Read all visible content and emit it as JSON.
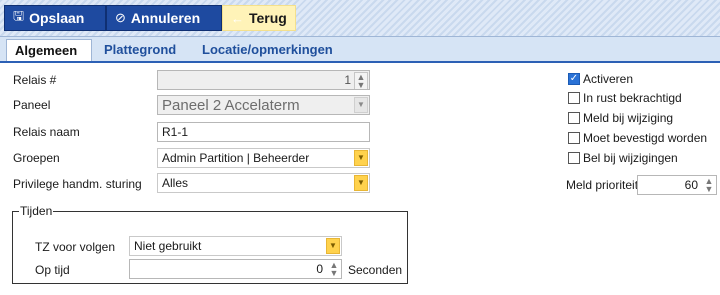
{
  "toolbar": {
    "save_label": "Opslaan",
    "cancel_label": "Annuleren",
    "back_label": "Terug"
  },
  "tabs": [
    {
      "label": "Algemeen",
      "active": true
    },
    {
      "label": "Plattegrond",
      "active": false
    },
    {
      "label": "Locatie/opmerkingen",
      "active": false
    }
  ],
  "form": {
    "relais_nr": {
      "label": "Relais #",
      "value": "1"
    },
    "paneel": {
      "label": "Paneel",
      "value": "Paneel 2 Accelaterm"
    },
    "relais_naam": {
      "label": "Relais naam",
      "value": "R1-1"
    },
    "groepen": {
      "label": "Groepen",
      "value": "Admin Partition | Beheerder"
    },
    "privilege": {
      "label": "Privilege handm. sturing",
      "value": "Alles"
    }
  },
  "checkboxes": [
    {
      "label": "Activeren",
      "checked": true
    },
    {
      "label": "In rust bekrachtigd",
      "checked": false
    },
    {
      "label": "Meld bij wijziging",
      "checked": false
    },
    {
      "label": "Moet bevestigd worden",
      "checked": false
    },
    {
      "label": "Bel bij wijzigingen",
      "checked": false
    }
  ],
  "meld_prioriteit": {
    "label": "Meld prioriteit",
    "value": "60"
  },
  "tijden": {
    "legend": "Tijden",
    "tz_label": "TZ voor volgen",
    "tz_value": "Niet gebruikt",
    "op_tijd_label": "Op tijd",
    "op_tijd_value": "0",
    "unit": "Seconden"
  },
  "colors": {
    "accent": "#1e4aa0",
    "back_button": "#fff3b8",
    "dropdown_button": "#ffd24d",
    "checkbox_checked": "#2a72d6"
  },
  "icons": {
    "save": "save-icon",
    "cancel": "cancel-icon",
    "back": "back-arrow-icon",
    "dropdown": "chevron-down-icon",
    "spinner": "spinner-icon"
  }
}
